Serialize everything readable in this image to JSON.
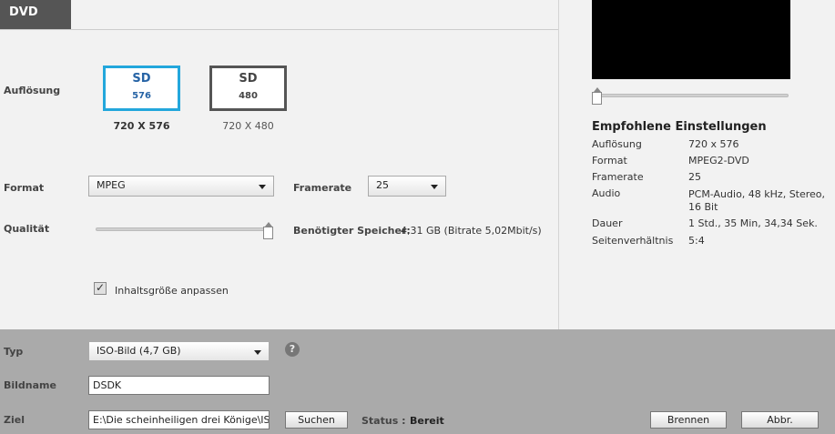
{
  "header": {
    "tab": "DVD"
  },
  "resolution": {
    "label": "Auflösung",
    "options": [
      {
        "top": "SD",
        "bottom": "576",
        "caption": "720 X 576"
      },
      {
        "top": "SD",
        "bottom": "480",
        "caption": "720 X 480"
      }
    ],
    "selected": "576"
  },
  "format": {
    "label": "Format",
    "value": "MPEG"
  },
  "framerate": {
    "label": "Framerate",
    "value": "25"
  },
  "quality": {
    "label": "Qualität",
    "level": 1.0,
    "storage_label": "Benötigter Speicher:",
    "storage_value": "4,31 GB (Bitrate 5,02Mbit/s)"
  },
  "fit_content": {
    "label": "Inhaltsgröße anpassen",
    "checked": true
  },
  "recommended": {
    "title": "Empfohlene Einstellungen",
    "rows": [
      {
        "key": "Auflösung",
        "value": "720 x 576"
      },
      {
        "key": "Format",
        "value": "MPEG2-DVD"
      },
      {
        "key": "Framerate",
        "value": "25"
      },
      {
        "key": "Audio",
        "value": "PCM-Audio, 48 kHz, Stereo, 16 Bit"
      },
      {
        "key": "Dauer",
        "value": "1 Std., 35 Min, 34,34 Sek."
      },
      {
        "key": "Seitenverhältnis",
        "value": "5:4"
      }
    ]
  },
  "bottom": {
    "type_label": "Typ",
    "type_value": "ISO-Bild (4,7 GB)",
    "help_icon": "?",
    "image_name_label": "Bildname",
    "image_name_value": "DSDK",
    "target_label": "Ziel",
    "target_value": "E:\\Die scheinheiligen drei Könige\\ISO",
    "search_button": "Suchen",
    "status_label": "Status :",
    "status_value": "Bereit",
    "burn_button": "Brennen",
    "cancel_button": "Abbr."
  },
  "icons": {
    "checkmark": "check-icon",
    "help": "help-icon",
    "dropdown": "caret-down-icon"
  },
  "colors": {
    "selected_border": "#23a7dc",
    "selected_text": "#2663a5",
    "bottom_panel": "#aaaaaa",
    "header_tab": "#555555"
  }
}
